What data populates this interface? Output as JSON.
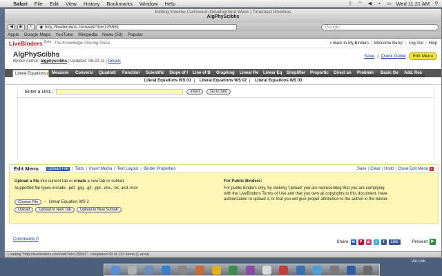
{
  "menubar": {
    "app": "Safari",
    "items": [
      "File",
      "Edit",
      "View",
      "History",
      "Bookmarks",
      "Window",
      "Help"
    ],
    "clock": "Wed 11:21 AM"
  },
  "window": {
    "title_top": "Editing timeline Curriculum Development Week | Timetoast timelines",
    "title": "AlgPhyScibhs"
  },
  "toolbar": {
    "url": "http://livebinders.com/edit?id=125581",
    "search_placeholder": "Google"
  },
  "bookmarks": [
    "Apple",
    "Google Maps",
    "YouTube",
    "Wikipedia",
    "News (53)",
    "Popular"
  ],
  "lb": {
    "logo": "LiveBinders",
    "beta": "Beta",
    "tagline": "The Knowledge Sharing Place",
    "back": "Back to My Binders",
    "welcome": "Welcome Barry!",
    "logout": "Log Out",
    "help": "Help"
  },
  "binder": {
    "title": "AlgPhyScibhs",
    "author_label": "Binder Author:",
    "author": "algphyscibhs",
    "updated": "Updated: 06-22-11",
    "details": "Details",
    "save": "Save",
    "quick_guide": "Quick Guide",
    "edit_menu": "Edit Menu"
  },
  "tabs": [
    "Literal Equations",
    "Measure",
    "Conversi",
    "Quadrati",
    "Function",
    "Scientific",
    "Slope of l",
    "Line of B",
    "Graphing",
    "Linear Re",
    "Linear Eq",
    "Simplifier",
    "Proportic",
    "Direct an",
    "Problem",
    "Basic Ge",
    "Add. Res"
  ],
  "subtabs": [
    "Literal Equations WS 01",
    "Literal Equations WS 02",
    "Literal Equations WS 03"
  ],
  "content": {
    "enter_url": "Enter a URL:",
    "insert": "Insert",
    "go_to_site": "Go to Site"
  },
  "edit_menu": {
    "title": "Edit Menu",
    "links": [
      "Upload File",
      "Tabs",
      "Insert Media",
      "Text Layout",
      "Binder Properties"
    ],
    "right_links": [
      "Save",
      "Clear",
      "Undo",
      "Close Edit Menu"
    ],
    "upload_line1_pre": "Upload a file",
    "upload_line1_mid": " into current tab or ",
    "upload_line1_bold": "create",
    "upload_line1_post": " a new tab or subtab:",
    "supported": "Supported file types include: .pdf, .jpg, .gif, .ppt, .doc, .txt, and .mov",
    "choose_file": "Choose File",
    "file_name": "Linear Equation WS 2",
    "upload": "Upload",
    "upload_new_tab": "Upload to New Tab",
    "upload_new_subtab": "Upload to New Subtab",
    "public_title": "For Public Binders:",
    "public_text": "For public binders only, by clicking 'Upload' you are representing that you are complying with the LiveBinders Terms of Use and that you own all copyrights to this document, have authorization to upload it, or that you will give proper attribution to the author in the binder."
  },
  "footer": {
    "comments": "Comments 0",
    "share": "Share",
    "like": "Like",
    "present": "Present"
  },
  "status": "Loading \"http://livebinders.com/edit?id=125581\", completed 68 of 133 items (1 error)",
  "desktop": {
    "file_label": "Var.cwk"
  }
}
